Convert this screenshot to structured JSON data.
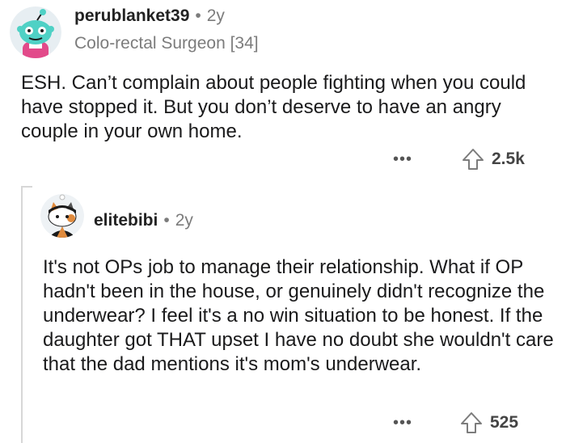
{
  "comment1": {
    "username": "perublanket39",
    "separator": "•",
    "time": "2y",
    "flair": "Colo-rectal Surgeon [34]",
    "body": "ESH. Can’t complain about people fighting when you could have stopped it. But you don’t deserve to have an angry couple in your own home.",
    "more_label": "•••",
    "upvotes": "2.5k"
  },
  "comment2": {
    "username": "elitebibi",
    "separator": "•",
    "time": "2y",
    "body": "It's not OPs job to manage their relationship. What if OP hadn't been in the house, or genuinely didn't recognize the underwear? I feel it's a no win situation to be honest. If the daughter got THAT upset I have no doubt she wouldn't care that the dad mentions it's mom's underwear.",
    "more_label": "•••",
    "upvotes": "525"
  },
  "colors": {
    "avatar1_skin": "#4fd1c5",
    "avatar1_shirt": "#e24a8a",
    "avatar2_bg": "#eef2f5",
    "avatar2_fur": "#e08a3c",
    "avatar2_hat": "#1a1a1b",
    "muted_text": "#7c7c7c"
  },
  "icons": {
    "avatar1": "zombie-snoo-avatar",
    "avatar2": "cat-snoo-avatar",
    "upvote": "upvote-arrow-icon",
    "more": "more-options-icon"
  }
}
